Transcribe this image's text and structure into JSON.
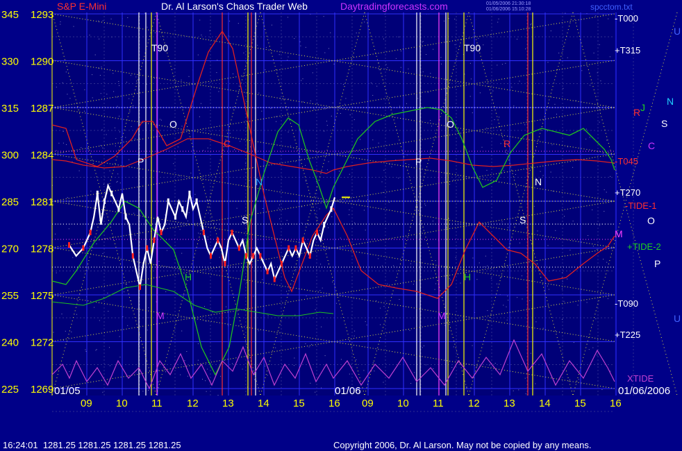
{
  "header": {
    "instrument": "S&P E-Mini",
    "center_title": "Dr. Al Larson's Chaos Trader Web",
    "site": "Daytradingforecasts.com",
    "stamp_line1": "01/05/2006 21:30:18",
    "stamp_line2": "01/06/2006 15:10:28",
    "file": "spcctom.txt"
  },
  "footer": {
    "quote": "16:24:01  1281.25 1281.25 1281.25 1281.25",
    "copyright": "Copyright 2006, Dr. Al Larson. May not be copied by any means."
  },
  "colors": {
    "background": "#000088",
    "plot_bg": "#000070",
    "price_white": "#ffffff",
    "price_red": "#ff2020",
    "grid_blue": "#3030ff",
    "grid_green": "#20a020",
    "dotted_yellow": "#e0e040",
    "axis_yellow": "#ffff00",
    "red_line": "#e02020",
    "green_line": "#20c020",
    "xtide_magenta": "#c040d0",
    "title_purple": "#cc33ff"
  },
  "chart_data": {
    "type": "line",
    "title": "Dr. Al Larson's Chaos Trader Web",
    "left_axis_angles": [
      "345",
      "330",
      "315",
      "300",
      "285",
      "270",
      "255",
      "240",
      "225"
    ],
    "left_axis_prices": [
      "1293",
      "1290",
      "1287",
      "1284",
      "1281",
      "1278",
      "1275",
      "1272",
      "1269"
    ],
    "y_range": [
      1269,
      1293
    ],
    "x_labels_day1": [
      "09",
      "10",
      "11",
      "12",
      "13",
      "14",
      "15",
      "16"
    ],
    "x_labels_day2": [
      "09",
      "10",
      "11",
      "12",
      "13",
      "14",
      "15",
      "16"
    ],
    "date_labels": [
      "01/05",
      "01/06",
      "01/06/2006"
    ],
    "right_labels": [
      "-T000",
      "+T315",
      "-T045",
      "+T270",
      "-TIDE-1",
      "+TIDE-2",
      "-T090",
      "+T225",
      "XTIDE"
    ],
    "planet_letters_right": [
      "U",
      "N",
      "J",
      "R",
      "S",
      "C",
      "O",
      "P",
      "M",
      "U"
    ],
    "chart_letters": [
      "T90",
      "O",
      "P",
      "C",
      "N",
      "S",
      "H",
      "M",
      "T90",
      "O",
      "P",
      "N",
      "S",
      "H",
      "M",
      "R"
    ],
    "price_series": {
      "name": "S&P E-Mini",
      "x_hours": [
        8.5,
        8.7,
        8.9,
        9.0,
        9.1,
        9.2,
        9.3,
        9.4,
        9.5,
        9.6,
        9.7,
        9.8,
        9.9,
        10.0,
        10.1,
        10.2,
        10.3,
        10.4,
        10.5,
        10.6,
        10.7,
        10.8,
        10.9,
        11.0,
        11.1,
        11.2,
        11.3,
        11.4,
        11.5,
        11.6,
        11.7,
        11.8,
        11.9,
        12.0,
        12.1,
        12.2,
        12.3,
        12.4,
        12.5,
        12.6,
        12.7,
        12.8,
        12.9,
        13.0,
        13.1,
        13.2,
        13.3,
        13.4,
        13.5,
        13.6,
        13.7,
        13.8,
        13.9,
        14.0,
        14.1,
        14.2,
        14.3,
        14.4,
        14.5,
        14.6,
        14.7,
        14.8,
        14.9,
        15.0,
        15.1,
        15.2,
        15.3,
        15.4,
        15.5,
        15.6,
        15.7,
        15.8,
        15.9,
        16.0
      ],
      "values": [
        1278.2,
        1277.5,
        1278.0,
        1278.5,
        1279.0,
        1280.0,
        1281.5,
        1279.5,
        1281.0,
        1282.0,
        1281.5,
        1281.0,
        1280.5,
        1281.5,
        1280.0,
        1279.5,
        1277.5,
        1276.5,
        1275.5,
        1277.0,
        1278.0,
        1277.0,
        1278.5,
        1280.0,
        1279.0,
        1279.5,
        1281.0,
        1280.5,
        1280.0,
        1281.0,
        1280.5,
        1280.0,
        1281.5,
        1280.5,
        1281.0,
        1280.0,
        1279.0,
        1278.0,
        1277.5,
        1278.0,
        1278.5,
        1278.0,
        1277.0,
        1278.5,
        1279.0,
        1278.5,
        1278.0,
        1278.5,
        1277.5,
        1277.0,
        1277.5,
        1278.0,
        1277.5,
        1277.0,
        1276.5,
        1277.0,
        1276.0,
        1276.5,
        1277.0,
        1277.5,
        1278.0,
        1277.5,
        1278.0,
        1277.5,
        1278.5,
        1278.0,
        1277.5,
        1278.5,
        1279.0,
        1278.5,
        1279.5,
        1280.0,
        1280.5,
        1281.25
      ]
    },
    "last_price": 1281.25
  }
}
